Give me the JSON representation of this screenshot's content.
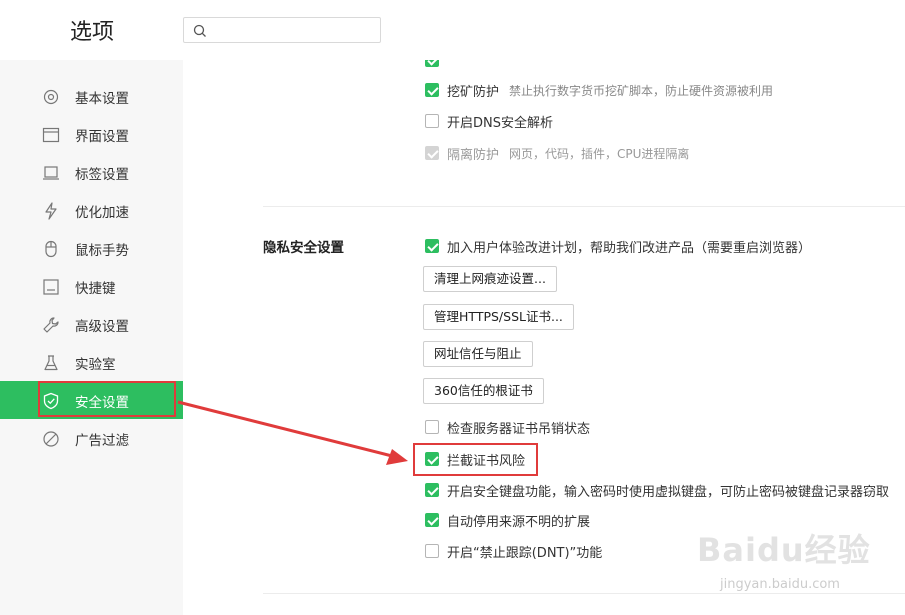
{
  "header": {
    "title": "选项",
    "search": {
      "placeholder": "",
      "icon": "search-icon"
    }
  },
  "sidebar": {
    "items": [
      {
        "label": "基本设置",
        "icon": "settings-icon"
      },
      {
        "label": "界面设置",
        "icon": "window-icon"
      },
      {
        "label": "标签设置",
        "icon": "tab-icon"
      },
      {
        "label": "优化加速",
        "icon": "lightning-icon"
      },
      {
        "label": "鼠标手势",
        "icon": "mouse-icon"
      },
      {
        "label": "快捷键",
        "icon": "keyboard-icon"
      },
      {
        "label": "高级设置",
        "icon": "wrench-icon"
      },
      {
        "label": "实验室",
        "icon": "flask-icon"
      },
      {
        "label": "安全设置",
        "icon": "shield-icon",
        "active": true
      },
      {
        "label": "广告过滤",
        "icon": "block-icon"
      }
    ],
    "active_color": "#2dbe60"
  },
  "content": {
    "top_options": [
      {
        "label": "挖矿防护",
        "desc": "禁止执行数字货币挖矿脚本，防止硬件资源被利用",
        "checked": true
      },
      {
        "label": "开启DNS安全解析",
        "desc": "",
        "checked": false
      },
      {
        "label": "隔离防护",
        "desc": "网页，代码，插件，CPU进程隔离",
        "checked": true,
        "disabled": true
      }
    ],
    "privacy": {
      "title": "隐私安全设置",
      "improve_program": "加入用户体验改进计划，帮助我们改进产品（需要重启浏览器）",
      "buttons": [
        "清理上网痕迹设置...",
        "管理HTTPS/SSL证书...",
        "网址信任与阻止",
        "360信任的根证书"
      ],
      "options": [
        {
          "label": "检查服务器证书吊销状态",
          "checked": false
        },
        {
          "label": "拦截证书风险",
          "checked": true
        },
        {
          "label": "开启安全键盘功能，输入密码时使用虚拟键盘，可防止密码被键盘记录器窃取",
          "checked": true
        },
        {
          "label": "自动停用来源不明的扩展",
          "checked": true
        },
        {
          "label": "开启“禁止跟踪(DNT)”功能",
          "checked": false
        }
      ]
    }
  },
  "annotation": {
    "color": "#e03b3b"
  },
  "watermark": {
    "logo": "Baidu经验",
    "url": "jingyan.baidu.com"
  }
}
